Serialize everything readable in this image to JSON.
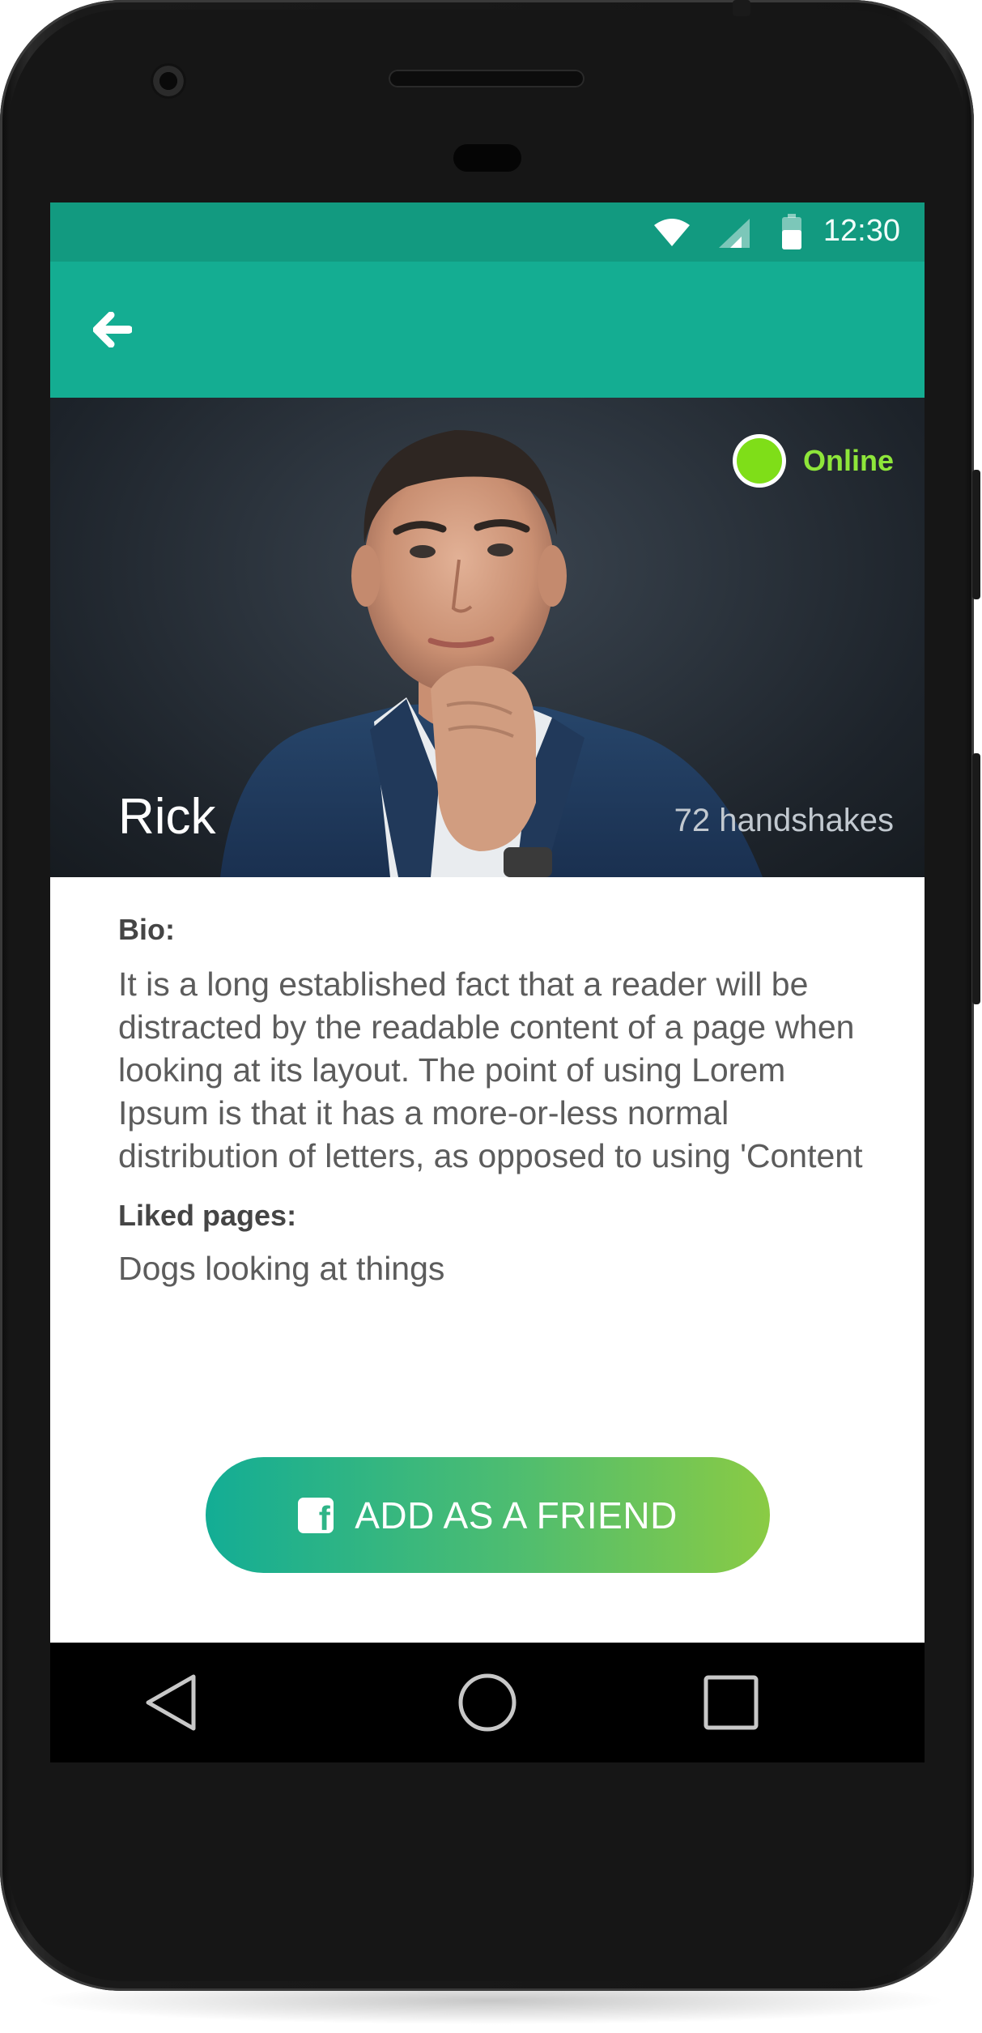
{
  "statusbar": {
    "time": "12:30",
    "icons": [
      "wifi-icon",
      "cellular-signal-icon",
      "battery-icon"
    ]
  },
  "appbar": {
    "back_icon": "arrow-left-icon"
  },
  "profile": {
    "name": "Rick",
    "handshakes": "72 handshakes",
    "status": "Online",
    "status_color": "#7fde18"
  },
  "bio": {
    "label": "Bio:",
    "text": "It is a long established fact that a reader will be distracted by the readable content of a page when looking at its layout. The point of using Lorem Ipsum is that it has a more-or-less normal distribution of letters, as opposed to using 'Content here, content here', making"
  },
  "liked_pages": {
    "label": "Liked pages:",
    "value": "Dogs looking at things"
  },
  "action": {
    "label": "ADD AS A FRIEND",
    "icon": "facebook-icon"
  },
  "navbar": {
    "icons": [
      "back-triangle-icon",
      "home-circle-icon",
      "recents-square-icon"
    ]
  },
  "colors": {
    "statusbar": "#129a80",
    "appbar": "#14ad92",
    "button_gradient_start": "#13ad95",
    "button_gradient_end": "#8acb44"
  }
}
